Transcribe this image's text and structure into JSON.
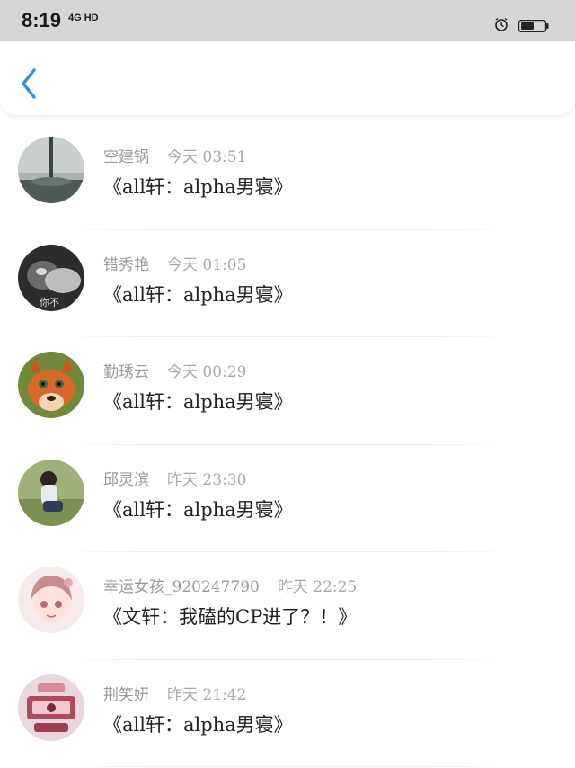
{
  "status_bar": {
    "time": "8:19",
    "signal_text": "4G HD",
    "icons": [
      "alarm-icon",
      "battery-icon"
    ]
  },
  "nav": {
    "back_icon": "chevron-left-icon",
    "accent_color": "#2f8fe0"
  },
  "messages": [
    {
      "name": "空建锅",
      "time": "今天 03:51",
      "text": "《all轩：alpha男寝》"
    },
    {
      "name": "错秀艳",
      "time": "今天 01:05",
      "text": "《all轩：alpha男寝》",
      "avatar_caption": "你不"
    },
    {
      "name": "勤琇云",
      "time": "今天 00:29",
      "text": "《all轩：alpha男寝》"
    },
    {
      "name": "邱灵滨",
      "time": "昨天 23:30",
      "text": "《all轩：alpha男寝》"
    },
    {
      "name": "幸运女孩_920247790",
      "time": "昨天 22:25",
      "text": "《文轩：我磕的CP进了？！》"
    },
    {
      "name": "荆笑妍",
      "time": "昨天 21:42",
      "text": "《all轩：alpha男寝》"
    }
  ]
}
